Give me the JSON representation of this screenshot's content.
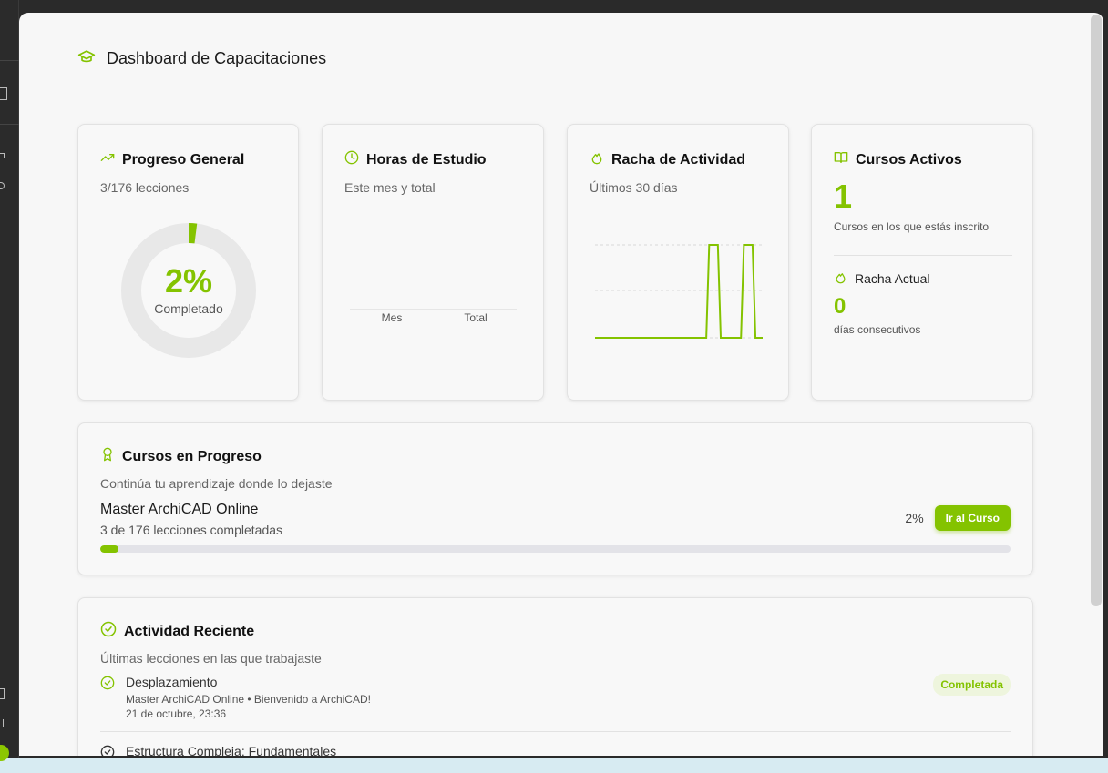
{
  "page": {
    "title": "Dashboard de Capacitaciones",
    "title_icon": "graduation-cap-icon"
  },
  "colors": {
    "accent": "#84c300",
    "background": "#f7f7f7",
    "dark_frame": "#2a2a2a"
  },
  "progreso_general": {
    "title": "Progreso General",
    "icon": "trending-up-icon",
    "subtitle": "3/176 lecciones",
    "percent_text": "2%",
    "percent_value": 2,
    "label": "Completado"
  },
  "horas_estudio": {
    "title": "Horas de Estudio",
    "icon": "clock-icon",
    "subtitle": "Este mes y total",
    "chart_labels": [
      "Mes",
      "Total"
    ]
  },
  "racha_actividad": {
    "title": "Racha de Actividad",
    "icon": "flame-icon",
    "subtitle": "Últimos 30 días"
  },
  "cursos_activos": {
    "title": "Cursos Activos",
    "icon": "book-open-icon",
    "count": "1",
    "count_label": "Cursos en los que estás inscrito",
    "racha_title": "Racha Actual",
    "racha_icon": "flame-icon",
    "racha_value": "0",
    "racha_label": "días consecutivos"
  },
  "cursos_en_progreso": {
    "title": "Cursos en Progreso",
    "icon": "award-icon",
    "subtitle": "Continúa tu aprendizaje donde lo dejaste",
    "course": {
      "name": "Master ArchiCAD Online",
      "detail": "3 de 176 lecciones completadas",
      "percent_text": "2%",
      "progress": 0.02,
      "button_label": "Ir al Curso"
    }
  },
  "actividad_reciente": {
    "title": "Actividad Reciente",
    "icon": "check-circle-icon",
    "subtitle": "Últimas lecciones en las que trabajaste",
    "items": [
      {
        "title": "Desplazamiento",
        "course": "Master ArchiCAD Online • Bienvenido a ArchiCAD!",
        "date": "21 de octubre, 23:36",
        "badge": "Completada"
      },
      {
        "title": "Estructura Compleja: Fundamentales"
      }
    ]
  },
  "chart_data": [
    {
      "type": "line",
      "x": [
        1,
        2,
        3,
        4,
        5,
        6,
        7,
        8,
        9,
        10,
        11,
        12,
        13,
        14,
        15,
        16,
        17,
        18,
        19,
        20,
        21,
        22,
        23,
        24,
        25,
        26,
        27,
        28,
        29,
        30
      ],
      "series": [
        {
          "values": [
            0,
            0,
            0,
            0,
            0,
            0,
            0,
            0,
            0,
            0,
            0,
            0,
            0,
            0,
            0,
            0,
            0,
            0,
            0,
            0,
            1,
            1,
            0,
            0,
            0,
            0,
            1,
            1,
            0,
            0
          ]
        }
      ],
      "ylim": [
        0,
        1
      ],
      "grid": true
    },
    {
      "type": "bar",
      "categories": [
        "Mes",
        "Total"
      ],
      "values": [
        0,
        0
      ]
    }
  ]
}
